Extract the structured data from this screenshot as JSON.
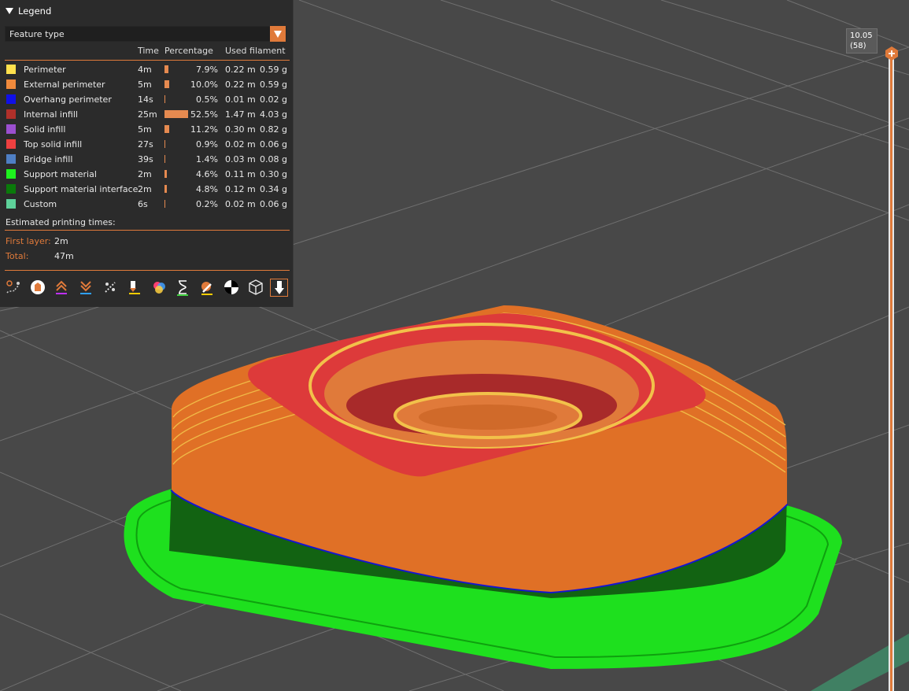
{
  "legend": {
    "title": "Legend",
    "view_type": "Feature type",
    "headers": {
      "time": "Time",
      "percentage": "Percentage",
      "used_filament": "Used filament"
    },
    "rows": [
      {
        "name": "Perimeter",
        "color": "#ffe14d",
        "time": "4m",
        "percent": "7.9%",
        "percent_value": 7.9,
        "length": "0.22 m",
        "weight": "0.59 g"
      },
      {
        "name": "External perimeter",
        "color": "#f08a3c",
        "time": "5m",
        "percent": "10.0%",
        "percent_value": 10.0,
        "length": "0.22 m",
        "weight": "0.59 g"
      },
      {
        "name": "Overhang perimeter",
        "color": "#1010e8",
        "time": "14s",
        "percent": "0.5%",
        "percent_value": 0.5,
        "length": "0.01 m",
        "weight": "0.02 g"
      },
      {
        "name": "Internal infill",
        "color": "#b0302a",
        "time": "25m",
        "percent": "52.5%",
        "percent_value": 52.5,
        "length": "1.47 m",
        "weight": "4.03 g"
      },
      {
        "name": "Solid infill",
        "color": "#9b4fcf",
        "time": "5m",
        "percent": "11.2%",
        "percent_value": 11.2,
        "length": "0.30 m",
        "weight": "0.82 g"
      },
      {
        "name": "Top solid infill",
        "color": "#ee4040",
        "time": "27s",
        "percent": "0.9%",
        "percent_value": 0.9,
        "length": "0.02 m",
        "weight": "0.06 g"
      },
      {
        "name": "Bridge infill",
        "color": "#4f7fc4",
        "time": "39s",
        "percent": "1.4%",
        "percent_value": 1.4,
        "length": "0.03 m",
        "weight": "0.08 g"
      },
      {
        "name": "Support material",
        "color": "#1ef21e",
        "time": "2m",
        "percent": "4.6%",
        "percent_value": 4.6,
        "length": "0.11 m",
        "weight": "0.30 g"
      },
      {
        "name": "Support material interface",
        "color": "#0a7a0a",
        "time": "2m",
        "percent": "4.8%",
        "percent_value": 4.8,
        "length": "0.12 m",
        "weight": "0.34 g"
      },
      {
        "name": "Custom",
        "color": "#5ed19a",
        "time": "6s",
        "percent": "0.2%",
        "percent_value": 0.2,
        "length": "0.02 m",
        "weight": "0.06 g"
      }
    ],
    "estimated_title": "Estimated printing times:",
    "first_layer_label": "First layer:",
    "first_layer_value": "2m",
    "total_label": "Total:",
    "total_value": "47m"
  },
  "toolbar": [
    "travel-icon",
    "retractions-icon",
    "deretractions-icon",
    "wipes-icon",
    "seams-icon",
    "tool-changes-icon",
    "color-changes-icon",
    "pause-prints-icon",
    "custom-gcodes-icon",
    "center-of-gravity-icon",
    "shells-icon",
    "tool-marker-icon"
  ],
  "layer_slider": {
    "height_value": "10.05",
    "layer_label": "(58)"
  },
  "colors": {
    "accent": "#e07a3a",
    "panel": "#2b2b2b",
    "background": "#4a4a4a"
  }
}
